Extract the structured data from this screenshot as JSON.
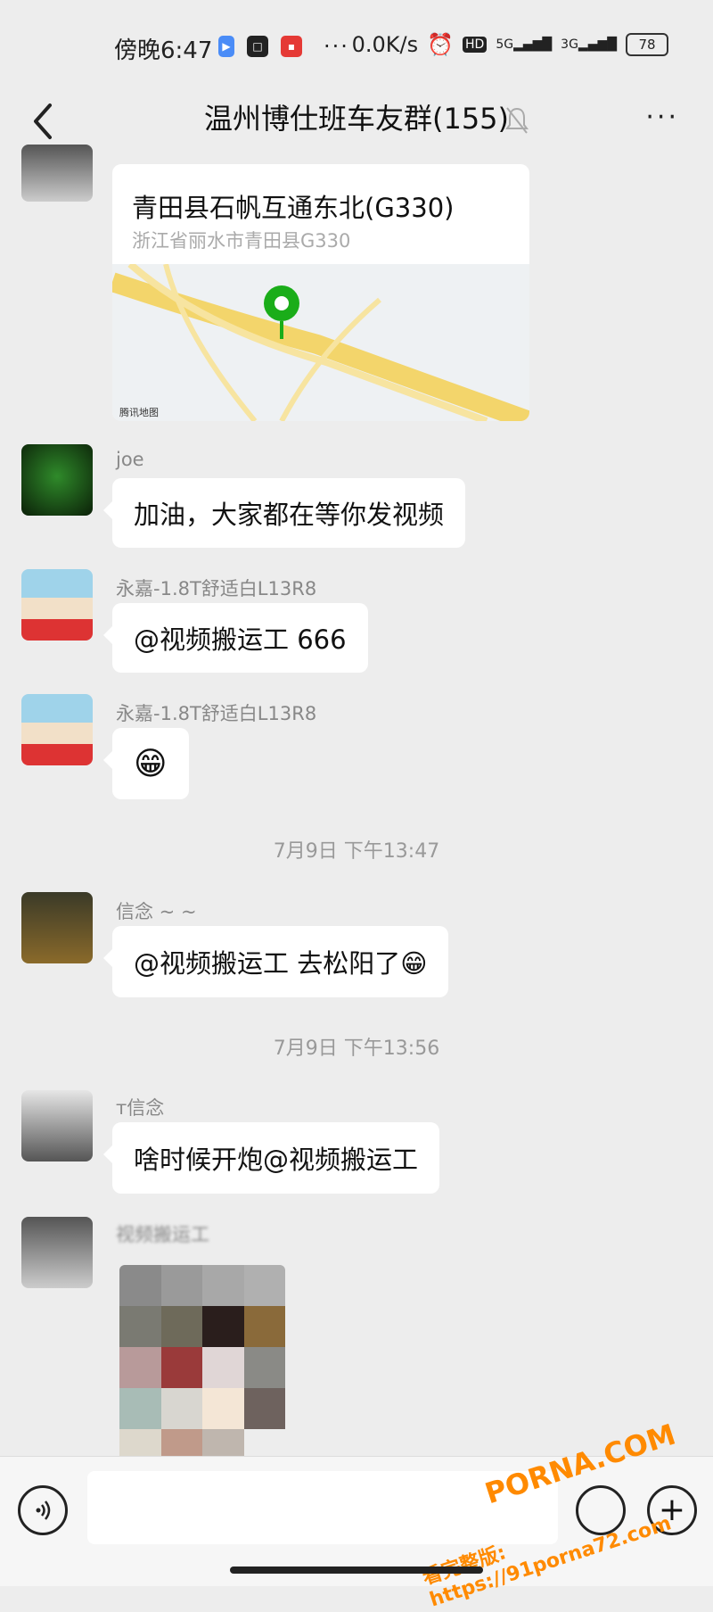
{
  "status_bar": {
    "time": "傍晚6:47",
    "net_speed": "0.0K/s",
    "hd": "HD",
    "sig1": "5G",
    "sig2": "3G",
    "battery": "78",
    "more_dots": "···"
  },
  "header": {
    "title": "温州博仕班车友群(155)",
    "more": "···"
  },
  "messages": {
    "loc": {
      "title": "青田县石帆互通东北(G330)",
      "address": "浙江省丽水市青田县G330",
      "map_credit": "腾讯地图"
    },
    "m1": {
      "nick": "joe",
      "text": "加油，大家都在等你发视频"
    },
    "m2": {
      "nick": "永嘉-1.8T舒适白L13R8",
      "text": "@视频搬运工  666"
    },
    "m3": {
      "nick": "永嘉-1.8T舒适白L13R8",
      "emoji": "😁"
    },
    "ts1": "7月9日 下午13:47",
    "m4": {
      "nick": "信念 ~ ~",
      "text": "@视频搬运工   去松阳了😁"
    },
    "ts2": "7月9日 下午13:56",
    "m5": {
      "nick": "т信念",
      "text": "啥时候开炮@视频搬运工"
    },
    "m6": {
      "nick": "视频搬运工"
    }
  },
  "watermark": {
    "brand": "PORNA.COM",
    "url": "看完整版: https://91porna72.com"
  },
  "colors": {
    "bg": "#ededed",
    "bubble": "#ffffff",
    "map_pin": "#1aad19",
    "watermark": "#ff8a00"
  }
}
